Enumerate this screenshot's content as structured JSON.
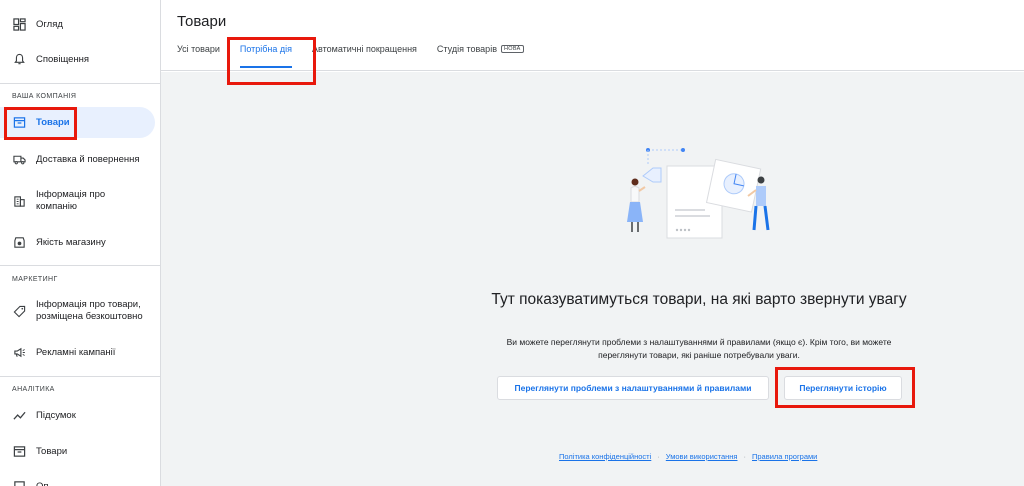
{
  "sidebar": {
    "items": [
      {
        "label": "Огляд",
        "icon": "dashboard-icon"
      },
      {
        "label": "Сповіщення",
        "icon": "bell-icon"
      },
      {
        "label": "Товари",
        "icon": "archive-box-icon"
      },
      {
        "label": "Доставка й повернення",
        "icon": "truck-icon"
      },
      {
        "label": "Інформація про компанію",
        "icon": "building-icon"
      },
      {
        "label": "Якість магазину",
        "icon": "store-quality-icon"
      },
      {
        "label": "Інформація про товари, розміщена безкоштовно",
        "icon": "tag-icon"
      },
      {
        "label": "Рекламні кампанії",
        "icon": "megaphone-icon"
      },
      {
        "label": "Підсумок",
        "icon": "trend-line-icon"
      },
      {
        "label": "Товари",
        "icon": "archive-box-icon"
      },
      {
        "label": "Оп",
        "icon": "generic-icon"
      }
    ],
    "sections": {
      "company": "ВАША КОМПАНІЯ",
      "marketing": "МАРКЕТИНГ",
      "analytics": "АНАЛІТИКА"
    }
  },
  "header": {
    "title": "Товари",
    "tabs": [
      {
        "label": "Усі товари"
      },
      {
        "label": "Потрібна дія"
      },
      {
        "label": "Автоматичні покращення"
      },
      {
        "label": "Студія товарів",
        "badge": "НОВА"
      }
    ]
  },
  "empty_state": {
    "title": "Тут показуватимуться товари, на які варто звернути увагу",
    "description": "Ви можете переглянути проблеми з налаштуваннями й правилами (якщо є). Крім того, ви можете переглянути товари, які раніше потребували уваги.",
    "btn_settings": "Переглянути проблеми з налаштуваннями й правилами",
    "btn_history": "Переглянути історію"
  },
  "footer": {
    "privacy": "Політика конфіденційності",
    "terms": "Умови використання",
    "policies": "Правила програми"
  },
  "colors": {
    "accent": "#1a73e8",
    "highlight": "#e8180c",
    "active_bg": "#e8f0fe",
    "main_bg": "#f1f3f4"
  }
}
